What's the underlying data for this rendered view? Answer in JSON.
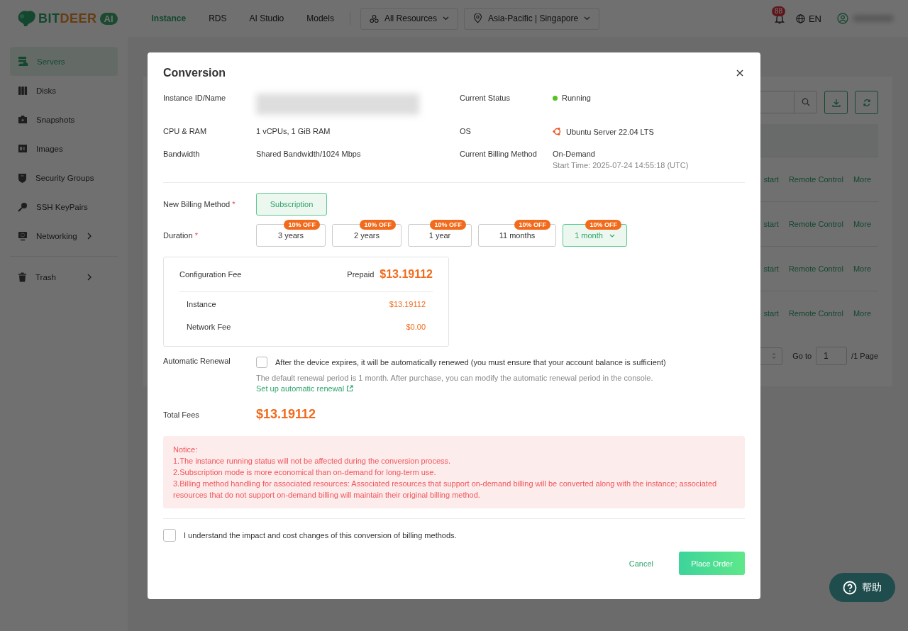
{
  "header": {
    "logo": {
      "first": "BIT",
      "second": "DEER",
      "badge": "AI"
    },
    "nav": [
      {
        "label": "Instance",
        "selected": true
      },
      {
        "label": "RDS",
        "selected": false
      },
      {
        "label": "AI Studio",
        "selected": false
      },
      {
        "label": "Models",
        "selected": false
      }
    ],
    "resource_filter": "All Resources",
    "region": "Asia-Pacific | Singapore",
    "notification_count": "88",
    "language": "EN"
  },
  "sidebar": {
    "items": [
      {
        "label": "Servers",
        "kind": "server",
        "selected": true,
        "expandable": false
      },
      {
        "label": "Disks",
        "kind": "disk",
        "selected": false,
        "expandable": false
      },
      {
        "label": "Snapshots",
        "kind": "camera",
        "selected": false,
        "expandable": false
      },
      {
        "label": "Images",
        "kind": "image",
        "selected": false,
        "expandable": false
      },
      {
        "label": "Security Groups",
        "kind": "shield",
        "selected": false,
        "expandable": false
      },
      {
        "label": "SSH KeyPairs",
        "kind": "key",
        "selected": false,
        "expandable": false
      },
      {
        "label": "Networking",
        "kind": "network",
        "selected": false,
        "expandable": true
      }
    ],
    "footer_items": [
      {
        "label": "Trash",
        "kind": "trash",
        "selected": false,
        "expandable": true
      }
    ]
  },
  "page": {
    "rows": [
      {
        "actions": [
          "start",
          "Remote Control",
          "More"
        ]
      },
      {
        "actions": [
          "start",
          "Remote Control",
          "More"
        ]
      },
      {
        "actions": [
          "start",
          "Remote Control",
          "More"
        ]
      },
      {
        "actions": [
          "start",
          "Remote Control",
          "More"
        ]
      }
    ],
    "pagination": {
      "goto_label": "Go to",
      "page": "1",
      "total": "/1 Page"
    }
  },
  "dialog": {
    "title": "Conversion",
    "info_left": [
      {
        "label": "Instance ID/Name",
        "kind": "redacted"
      },
      {
        "label": "CPU & RAM",
        "kind": "text",
        "value": "1 vCPUs, 1 GiB RAM"
      },
      {
        "label": "Bandwidth",
        "kind": "text",
        "value": "Shared Bandwidth/1024 Mbps"
      }
    ],
    "info_right": [
      {
        "label": "Current Status",
        "kind": "status",
        "value": "Running",
        "color": "#52c41a"
      },
      {
        "label": "OS",
        "kind": "os",
        "value": "Ubuntu Server 22.04 LTS"
      },
      {
        "label": "Current Billing Method",
        "kind": "text",
        "value": "On-Demand",
        "sub": "Start Time: 2025-07-24 14:55:18 (UTC)"
      }
    ],
    "billing_label": "New Billing Method",
    "billing_required": "*",
    "billing_options": [
      {
        "label": "Subscription",
        "selected": true
      }
    ],
    "duration_label": "Duration",
    "duration_required": "*",
    "durations": [
      {
        "label": "3 years",
        "badge": "10% OFF",
        "kind": "option",
        "selected": false
      },
      {
        "label": "2 years",
        "badge": "10% OFF",
        "kind": "option",
        "selected": false
      },
      {
        "label": "1 year",
        "badge": "10% OFF",
        "kind": "option",
        "selected": false
      },
      {
        "label": "11 months",
        "badge": "10% OFF",
        "kind": "option",
        "selected": false
      },
      {
        "label": "1 month",
        "badge": "10% OFF",
        "kind": "dropdown",
        "selected": true
      }
    ],
    "fees": {
      "label": "Configuration Fee",
      "mode": "Prepaid",
      "total": "$13.19112",
      "items": [
        {
          "label": "Instance",
          "value": "$13.19112"
        },
        {
          "label": "Network Fee",
          "value": "$0.00"
        }
      ]
    },
    "renewal": {
      "label": "Automatic Renewal",
      "checked": false,
      "text": "After the device expires, it will be automatically renewed (you must ensure that your account balance is sufficient)",
      "hint": "The default renewal period is 1 month. After purchase, you can modify the automatic renewal period in the console.",
      "link": "Set up automatic renewal"
    },
    "total_label": "Total Fees",
    "total": "$13.19112",
    "notice": [
      "Notice:",
      "1.The instance running status will not be affected during the conversion process.",
      "2.Subscription mode is more economical than on-demand for long-term use.",
      "3.Billing method handling for associated resources: Associated resources that support on-demand billing will be converted along with the instance; associated resources that do not support on-demand billing will maintain their original billing method."
    ],
    "agreement": {
      "checked": false,
      "text": "I understand the impact and cost changes of this conversion of billing methods."
    },
    "cancel": "Cancel",
    "submit": "Place Order"
  },
  "help": {
    "label": "帮助"
  }
}
